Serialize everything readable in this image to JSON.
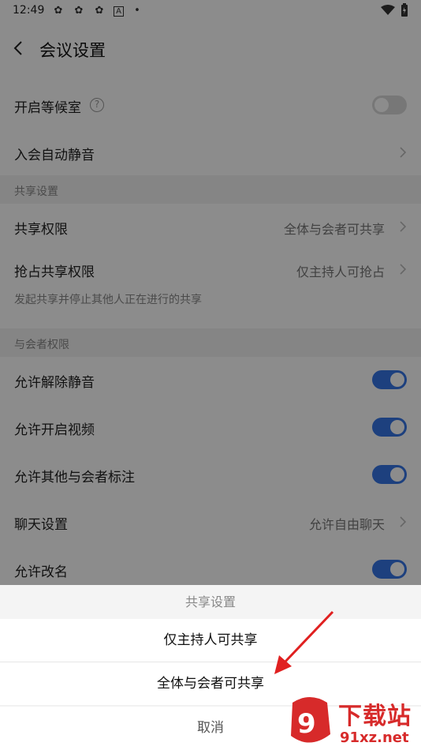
{
  "status_bar": {
    "time": "12:49"
  },
  "header": {
    "title": "会议设置"
  },
  "rows": {
    "waiting_room": "开启等候室",
    "auto_mute": "入会自动静音",
    "share_permission": {
      "label": "共享权限",
      "value": "全体与会者可共享"
    },
    "grab_share": {
      "label": "抢占共享权限",
      "value": "仅主持人可抢占"
    },
    "grab_hint": "发起共享并停止其他人正在进行的共享",
    "unmute": "允许解除静音",
    "video": "允许开启视频",
    "annotate": "允许其他与会者标注",
    "chat": {
      "label": "聊天设置",
      "value": "允许自由聊天"
    },
    "rename": "允许改名"
  },
  "sections": {
    "share": "共享设置",
    "attendee": "与会者权限"
  },
  "toggles": {
    "waiting_room": false,
    "unmute": true,
    "video": true,
    "annotate": true,
    "rename": true
  },
  "sheet": {
    "title": "共享设置",
    "options": [
      "仅主持人可共享",
      "全体与会者可共享"
    ],
    "cancel": "取消"
  },
  "watermark": {
    "brand": "下载站",
    "url": "91xz.net"
  },
  "colors": {
    "accent": "#3575e6",
    "arrow": "#e02020"
  }
}
